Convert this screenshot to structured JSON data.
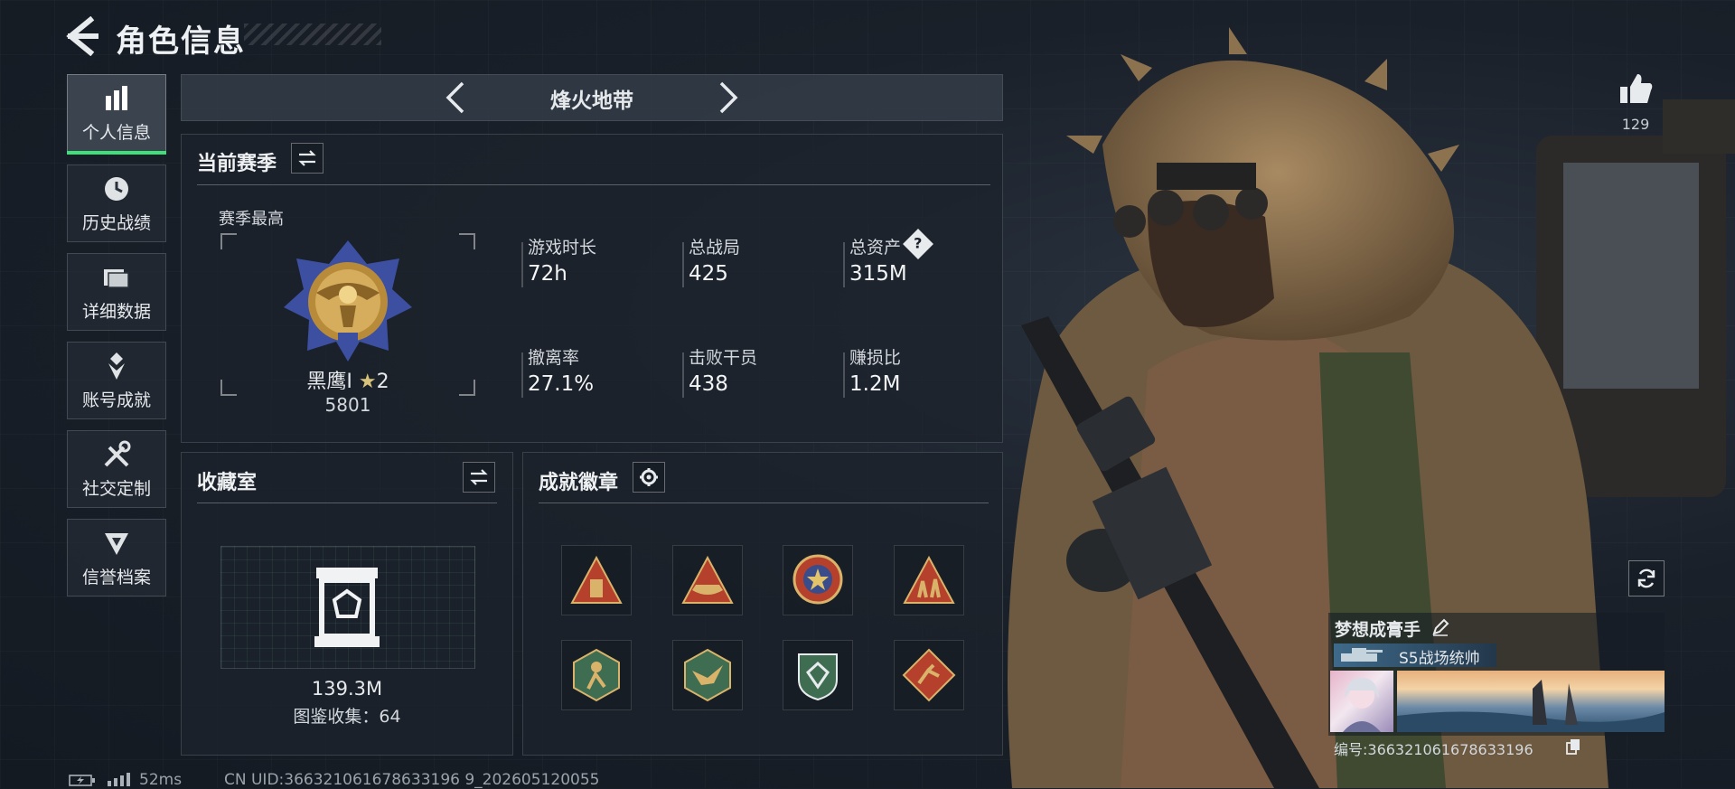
{
  "header": {
    "title": "角色信息"
  },
  "sidebar": {
    "items": [
      {
        "label": "个人信息",
        "icon": "bar-chart-icon",
        "active": true
      },
      {
        "label": "历史战绩",
        "icon": "history-icon"
      },
      {
        "label": "详细数据",
        "icon": "folder-icon"
      },
      {
        "label": "账号成就",
        "icon": "achievement-icon"
      },
      {
        "label": "社交定制",
        "icon": "tools-icon"
      },
      {
        "label": "信誉档案",
        "icon": "credit-icon"
      }
    ]
  },
  "mode": {
    "title": "烽火地带"
  },
  "season": {
    "title": "当前赛季",
    "best_label": "赛季最高",
    "rank_name": "黑鹰Ⅰ",
    "rank_stars": "2",
    "rank_score": "5801",
    "stats": [
      {
        "label": "游戏时长",
        "value": "72h"
      },
      {
        "label": "总战局",
        "value": "425"
      },
      {
        "label": "总资产",
        "value": "315M",
        "help": "?"
      },
      {
        "label": "撤离率",
        "value": "27.1%"
      },
      {
        "label": "击败干员",
        "value": "438"
      },
      {
        "label": "赚损比",
        "value": "1.2M"
      }
    ]
  },
  "collection": {
    "title": "收藏室",
    "value": "139.3M",
    "count_label": "图鉴收集：64"
  },
  "achievements": {
    "title": "成就徽章",
    "badges": [
      {
        "icon": "pyramid-badge-icon",
        "color": "#b5412c"
      },
      {
        "icon": "boat-badge-icon",
        "color": "#b5412c"
      },
      {
        "icon": "star-medal-badge-icon",
        "color": "#b5412c"
      },
      {
        "icon": "soldiers-badge-icon",
        "color": "#b5412c"
      },
      {
        "icon": "hex-runner-badge-icon",
        "color": "#3f6d52"
      },
      {
        "icon": "hex-bird-badge-icon",
        "color": "#3f6d52"
      },
      {
        "icon": "shield-badge-icon",
        "color": "#3f6d52"
      },
      {
        "icon": "runner-diamond-badge-icon",
        "color": "#b5412c"
      }
    ]
  },
  "likes": {
    "count": "129"
  },
  "player": {
    "name": "梦想成膏手",
    "title": "S5战场统帅",
    "id_label": "编号:366321061678633196"
  },
  "status": {
    "ping": "52ms",
    "uid": "CN UID:366321061678633196 9_202605120055"
  },
  "colors": {
    "accent": "#3ee07a",
    "badge_red": "#b5412c",
    "badge_green": "#3f6d52"
  }
}
